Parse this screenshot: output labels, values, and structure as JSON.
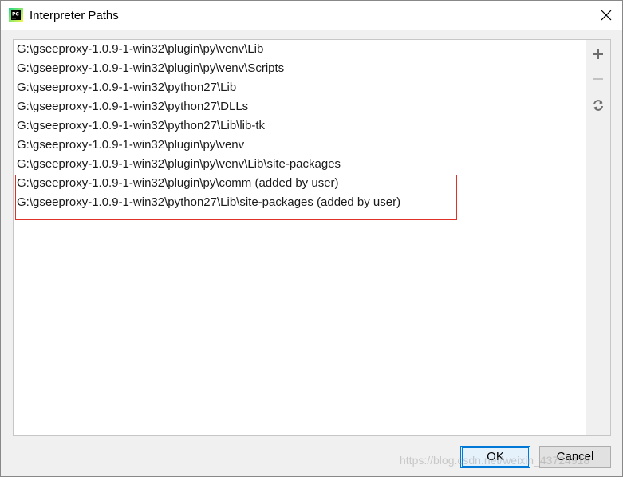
{
  "window": {
    "title": "Interpreter Paths",
    "app_icon": "pycharm-icon"
  },
  "paths": [
    "G:\\gseeproxy-1.0.9-1-win32\\plugin\\py\\venv\\Lib",
    "G:\\gseeproxy-1.0.9-1-win32\\plugin\\py\\venv\\Scripts",
    "G:\\gseeproxy-1.0.9-1-win32\\python27\\Lib",
    "G:\\gseeproxy-1.0.9-1-win32\\python27\\DLLs",
    "G:\\gseeproxy-1.0.9-1-win32\\python27\\Lib\\lib-tk",
    "G:\\gseeproxy-1.0.9-1-win32\\plugin\\py\\venv",
    "G:\\gseeproxy-1.0.9-1-win32\\plugin\\py\\venv\\Lib\\site-packages",
    "G:\\gseeproxy-1.0.9-1-win32\\plugin\\py\\comm  (added by user)",
    "G:\\gseeproxy-1.0.9-1-win32\\python27\\Lib\\site-packages  (added by user)"
  ],
  "toolbar": {
    "add_icon": "plus-icon",
    "remove_icon": "minus-icon",
    "refresh_icon": "refresh-icon"
  },
  "buttons": {
    "ok": "OK",
    "cancel": "Cancel"
  },
  "watermark": "https://blog.csdn.net/weixin_43724918",
  "colors": {
    "highlight": "#e0302a",
    "ok_border": "#0078d7"
  }
}
